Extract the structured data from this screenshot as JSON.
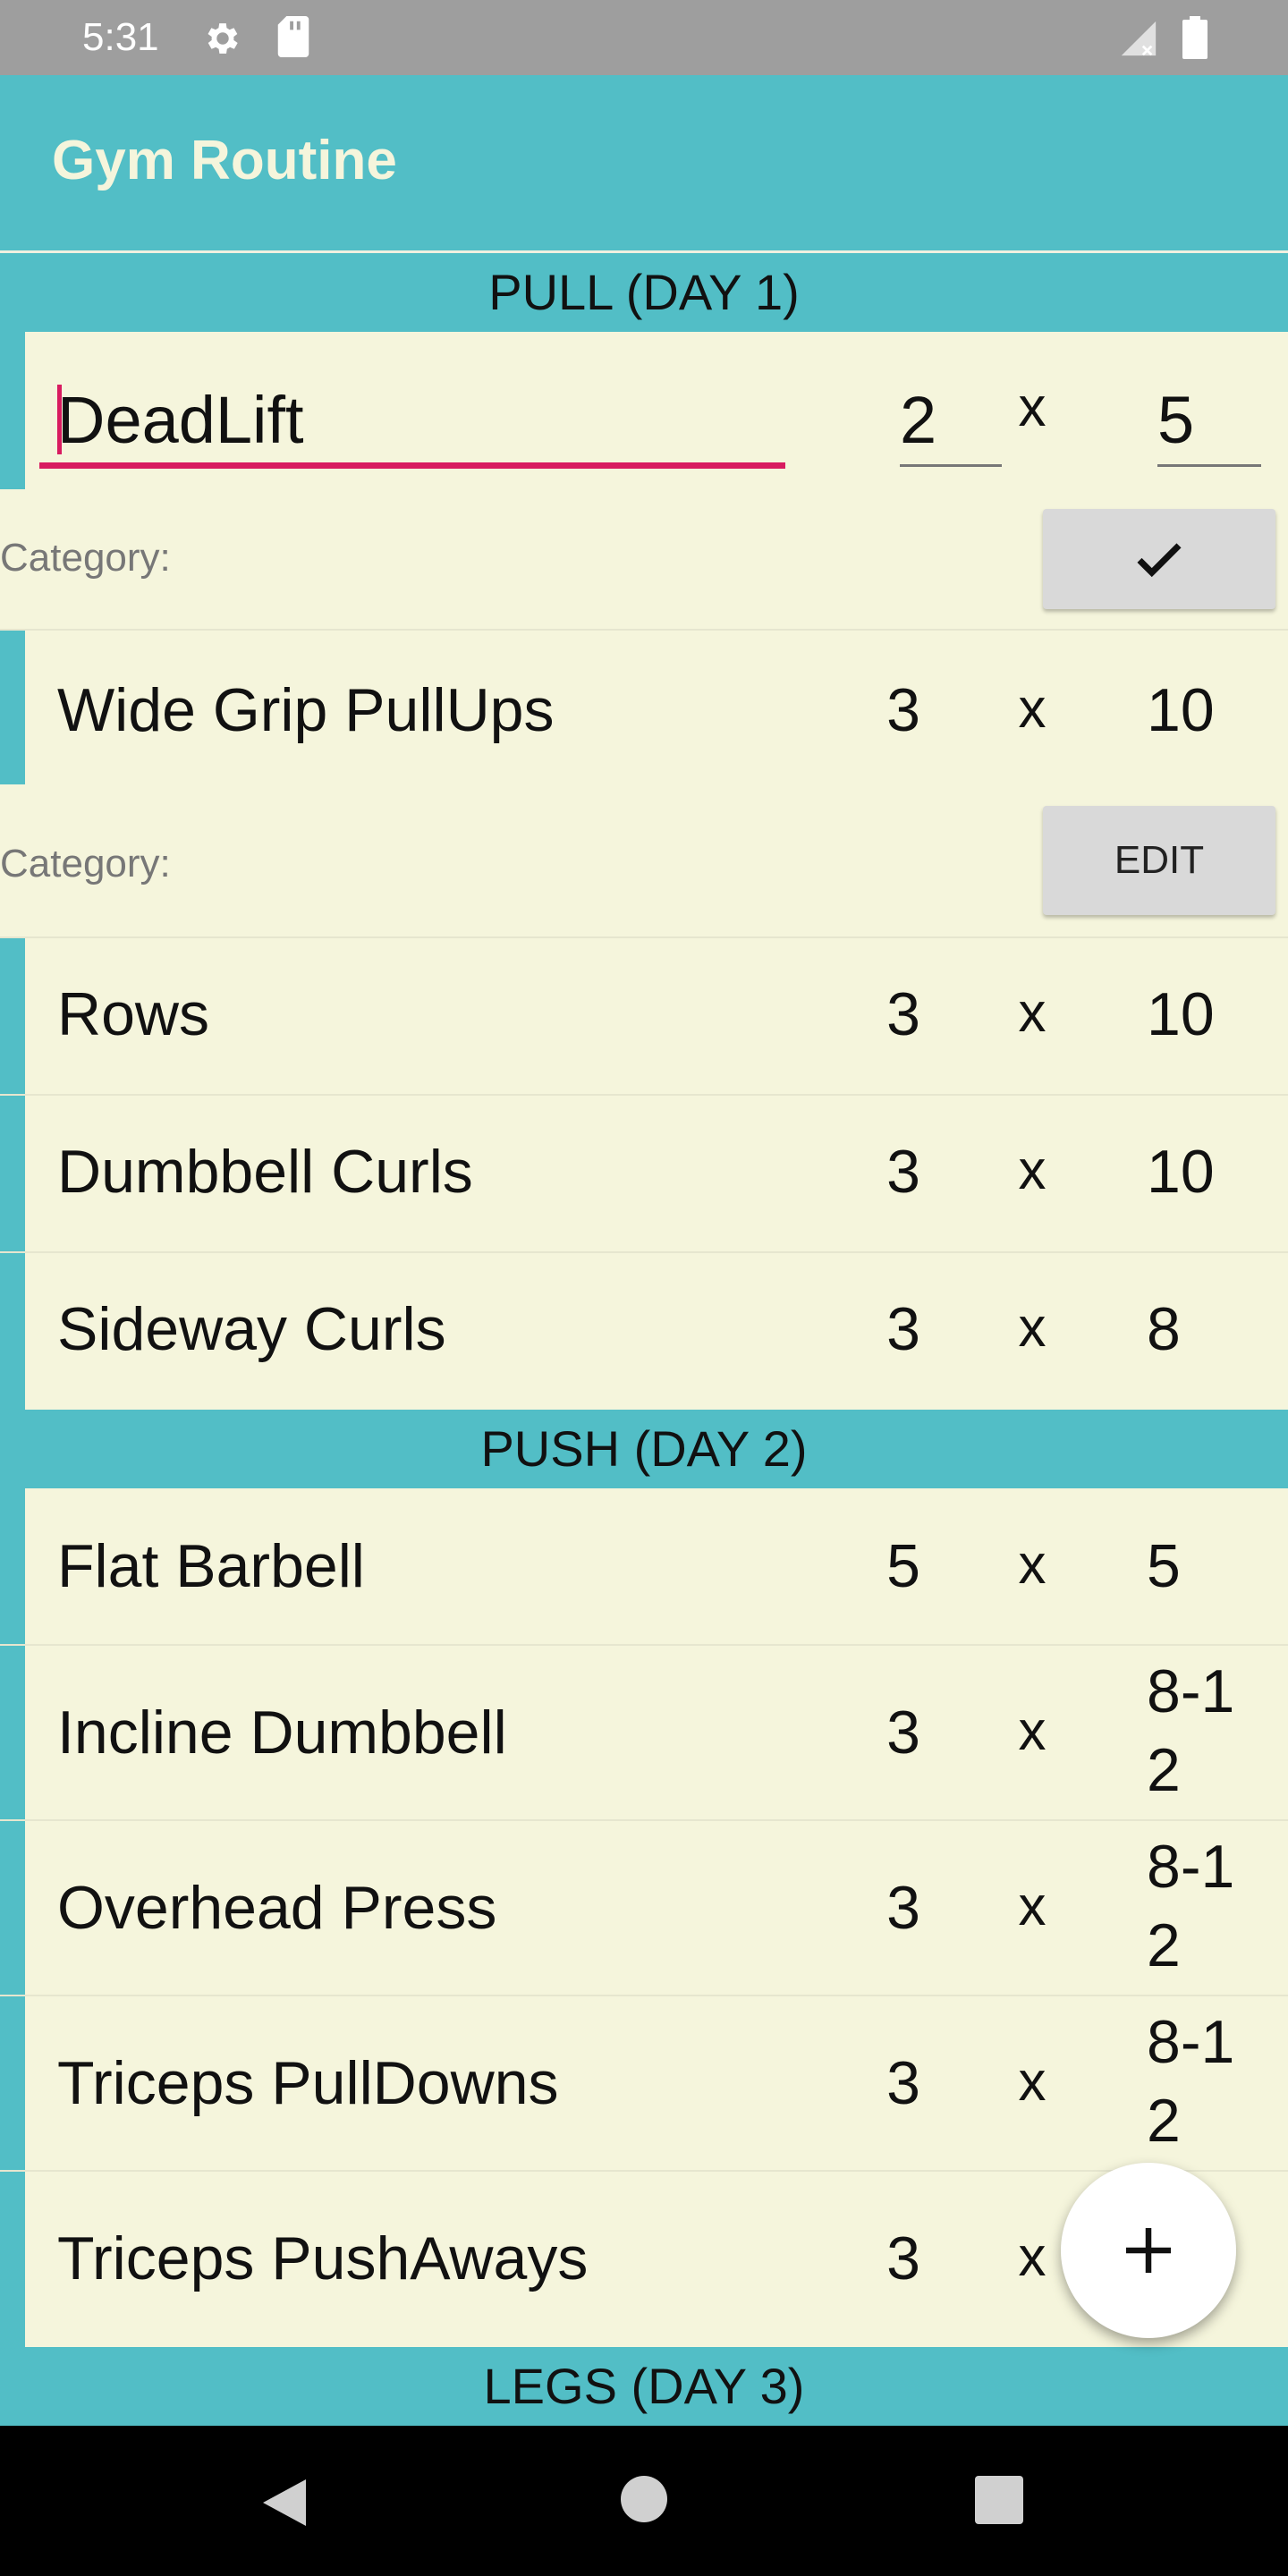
{
  "status_bar": {
    "time": "5:31"
  },
  "app_bar": {
    "title": "Gym Routine"
  },
  "sections": [
    {
      "header": "PULL (DAY 1)",
      "editing_exercise": {
        "name": "DeadLift",
        "sets": "2",
        "x": "x",
        "reps": "5",
        "category_label": "Category:",
        "confirm_icon": "check-icon"
      },
      "expanded_exercise": {
        "name": "Wide Grip PullUps",
        "sets": "3",
        "x": "x",
        "reps": "10",
        "category_label": "Category:",
        "edit_label": "EDIT"
      },
      "exercises": [
        {
          "name": "Rows",
          "sets": "3",
          "x": "x",
          "reps": "10"
        },
        {
          "name": "Dumbbell Curls",
          "sets": "3",
          "x": "x",
          "reps": "10"
        },
        {
          "name": "Sideway Curls",
          "sets": "3",
          "x": "x",
          "reps": "8"
        }
      ]
    },
    {
      "header": "PUSH (DAY 2)",
      "exercises": [
        {
          "name": "Flat Barbell",
          "sets": "5",
          "x": "x",
          "reps": "5"
        },
        {
          "name": "Incline Dumbbell",
          "sets": "3",
          "x": "x",
          "reps_line1": "8-1",
          "reps_line2": "2"
        },
        {
          "name": "Overhead Press",
          "sets": "3",
          "x": "x",
          "reps_line1": "8-1",
          "reps_line2": "2"
        },
        {
          "name": "Triceps PullDowns",
          "sets": "3",
          "x": "x",
          "reps_line1": "8-1",
          "reps_line2": "2"
        },
        {
          "name": "Triceps PushAways",
          "sets": "3",
          "x": "x"
        }
      ]
    },
    {
      "header": "LEGS (DAY 3)"
    }
  ],
  "fab": {
    "icon": "plus-icon"
  },
  "colors": {
    "accent": "#52bec6",
    "background": "#f5f5dc",
    "cursor": "#d81b60"
  }
}
